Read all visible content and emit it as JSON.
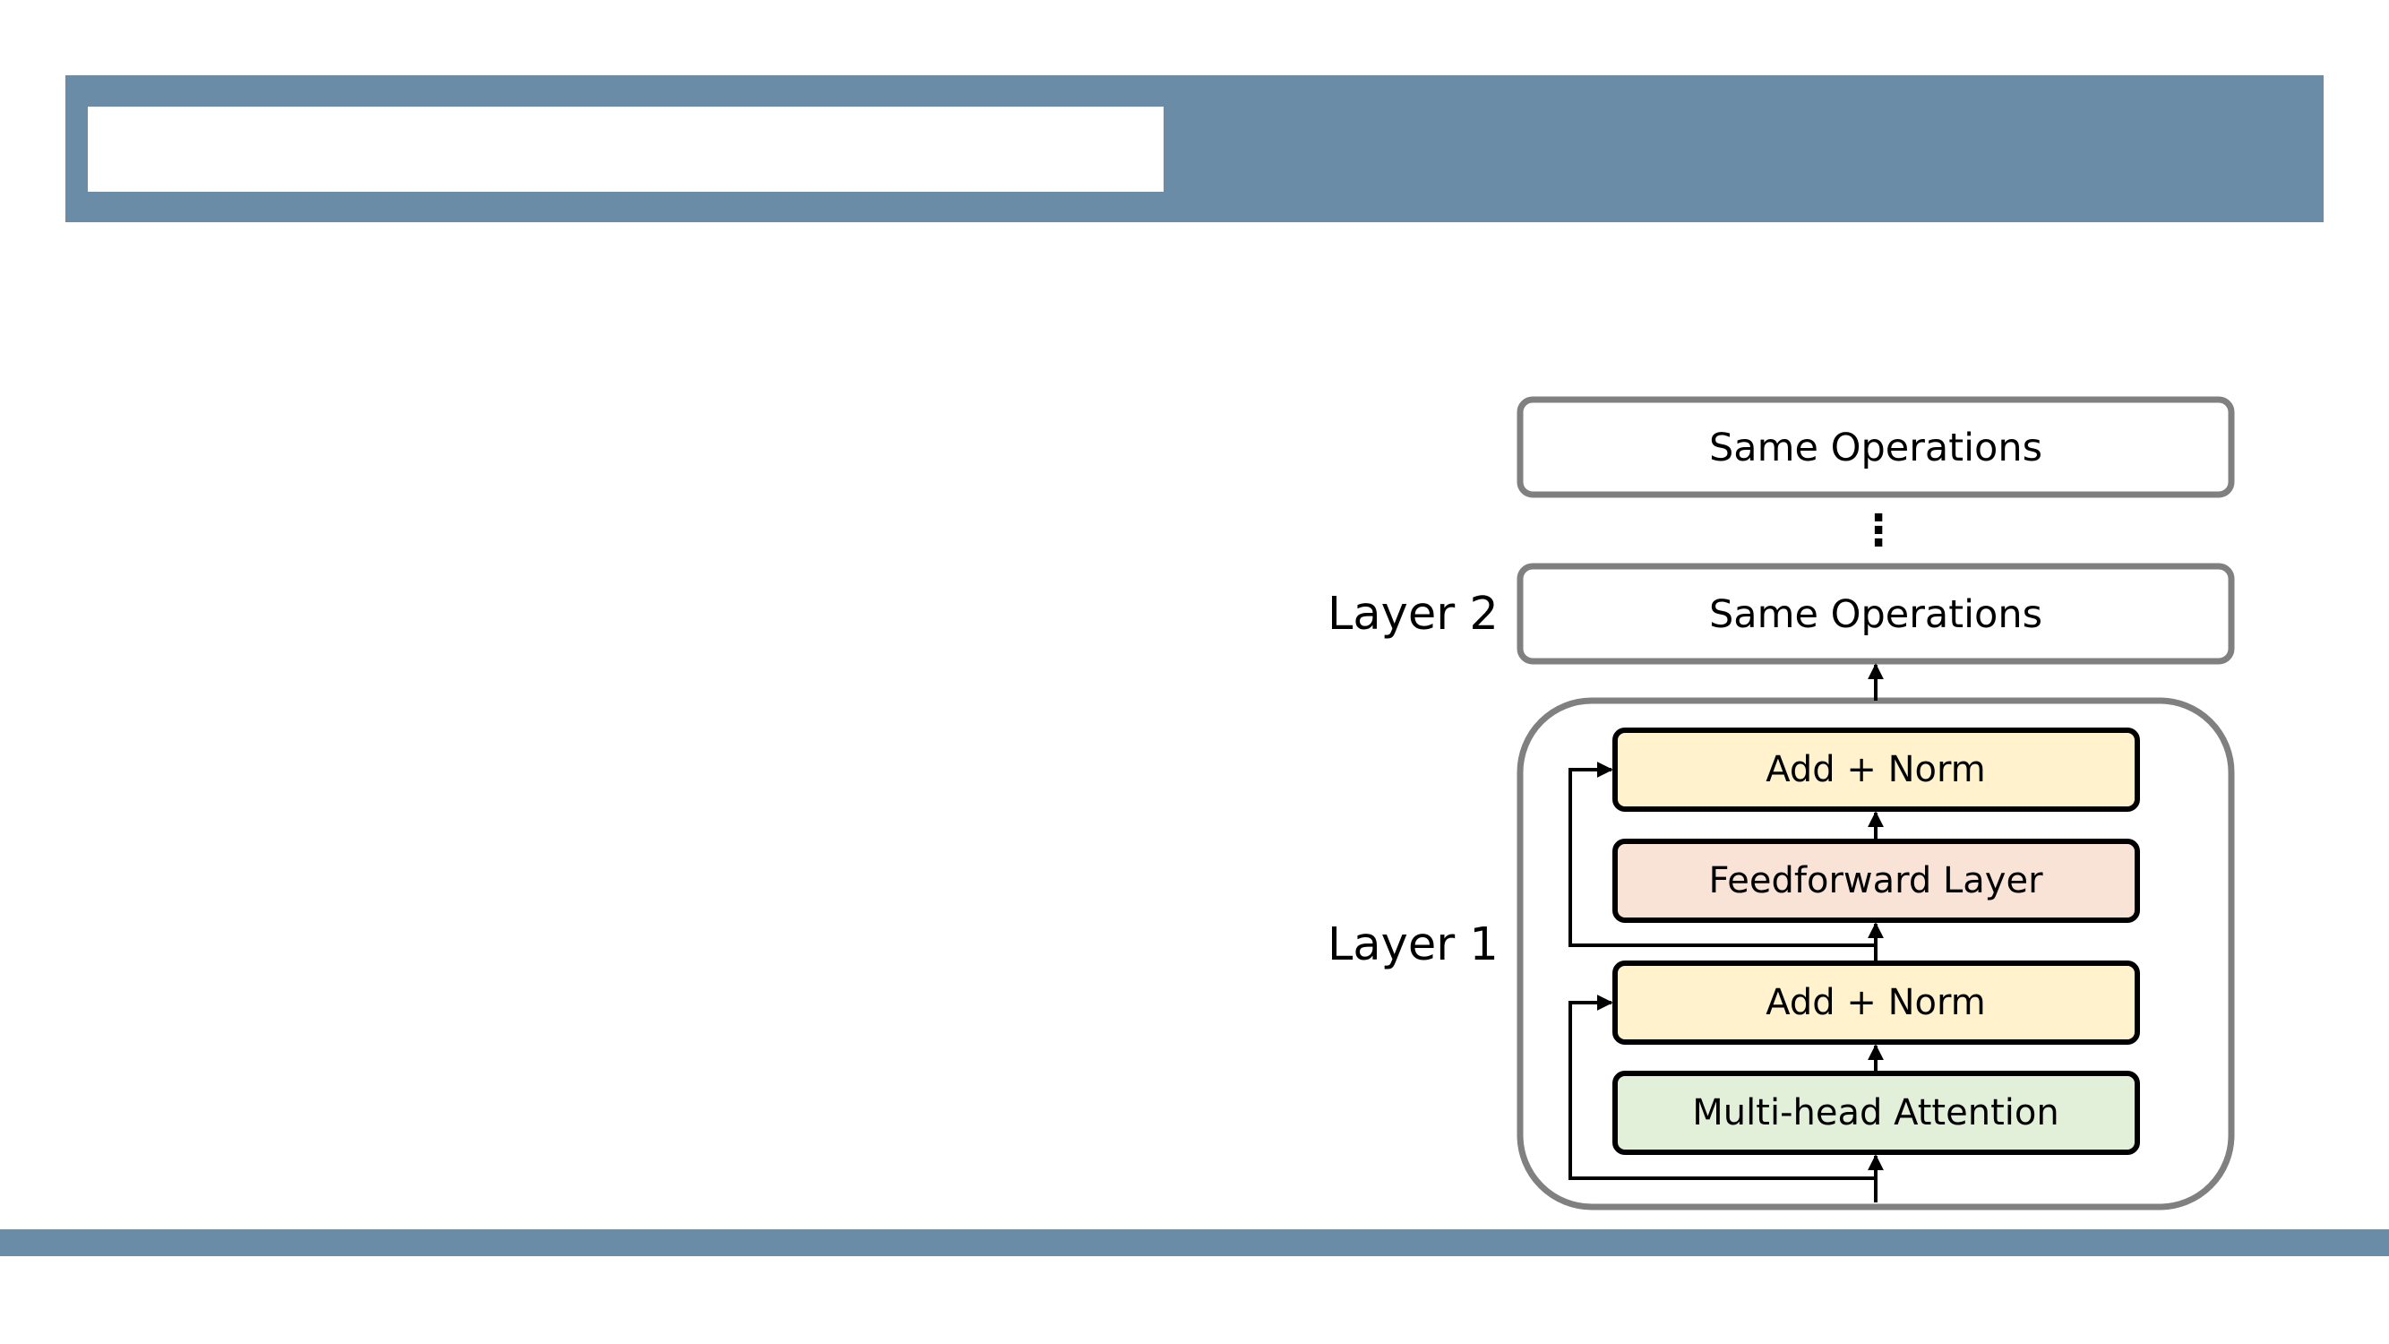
{
  "slide": {
    "title": "",
    "accent_color": "#6a8ca6"
  },
  "diagram": {
    "layers": {
      "layer2_label": "Layer 2",
      "layer1_label": "Layer 1"
    },
    "top_block": {
      "label": "Same Operations"
    },
    "ellipsis": "⋮",
    "layer2_block": {
      "label": "Same Operations"
    },
    "layer1": {
      "add_norm_top": {
        "label": "Add + Norm",
        "color": "#fff2cc"
      },
      "feedforward": {
        "label": "Feedforward Layer",
        "color": "#f9e3d6"
      },
      "add_norm_bottom": {
        "label": "Add + Norm",
        "color": "#fff2cc"
      },
      "attention": {
        "label": "Multi-head Attention",
        "color": "#e2efd9"
      }
    }
  }
}
